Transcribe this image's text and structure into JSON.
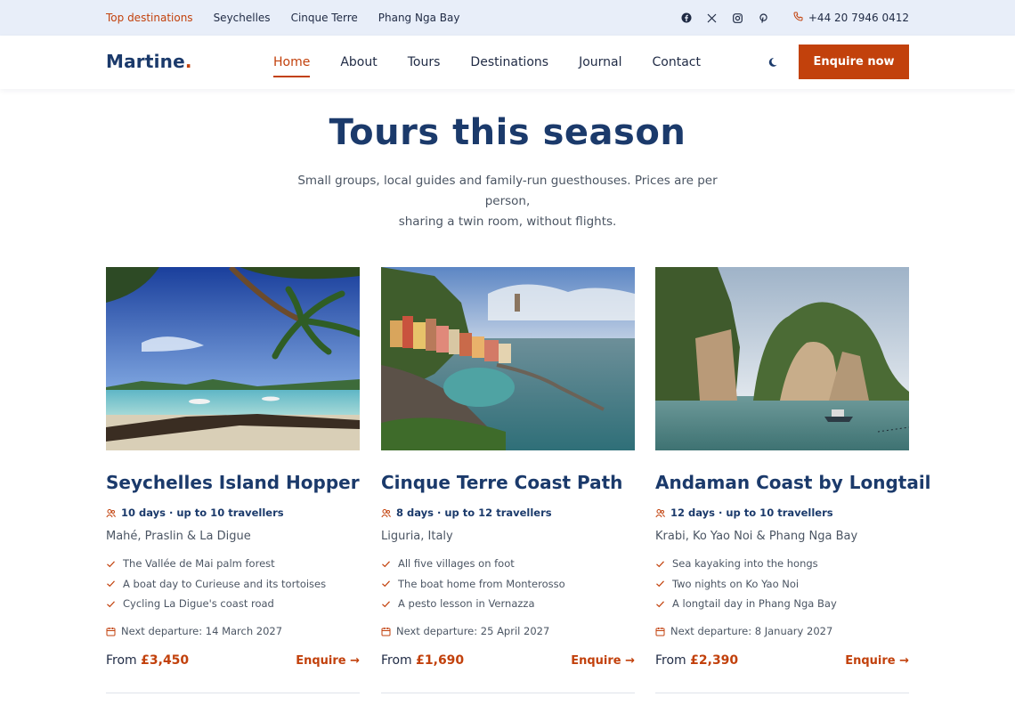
{
  "topbar": {
    "links": [
      {
        "label": "Top destinations"
      },
      {
        "label": "Seychelles"
      },
      {
        "label": "Cinque Terre"
      },
      {
        "label": "Phang Nga Bay"
      }
    ],
    "social_icons": [
      "facebook-icon",
      "x-icon",
      "instagram-icon",
      "pinterest-icon"
    ],
    "phone": "+44 20 7946 0412"
  },
  "header": {
    "logo": "Martine",
    "logo_dot": ".",
    "nav": [
      {
        "label": "Home"
      },
      {
        "label": "About"
      },
      {
        "label": "Tours"
      },
      {
        "label": "Destinations"
      },
      {
        "label": "Journal"
      },
      {
        "label": "Contact"
      }
    ],
    "cta": "Enquire now"
  },
  "hero": {
    "title": "Tours this season",
    "subtitle_line1": "Small groups, local guides and family-run guesthouses. Prices are per person,",
    "subtitle_line2": "sharing a twin room, without flights."
  },
  "tours": [
    {
      "title": "Seychelles Island Hopper",
      "meta": "10 days · up to 10 travellers",
      "location": "Mahé, Praslin & La Digue",
      "features": [
        "The Vallée de Mai palm forest",
        "A boat day to Curieuse and its tortoises",
        "Cycling La Digue's coast road"
      ],
      "departure": "Next departure: 14 March 2027",
      "price_prefix": "From",
      "price": "£3,450",
      "link": "Enquire →"
    },
    {
      "title": "Cinque Terre Coast Path",
      "meta": "8 days · up to 12 travellers",
      "location": "Liguria, Italy",
      "features": [
        "All five villages on foot",
        "The boat home from Monterosso",
        "A pesto lesson in Vernazza"
      ],
      "departure": "Next departure: 25 April 2027",
      "price_prefix": "From",
      "price": "£1,690",
      "link": "Enquire →"
    },
    {
      "title": "Andaman Coast by Longtail",
      "meta": "12 days · up to 10 travellers",
      "location": "Krabi, Ko Yao Noi & Phang Nga Bay",
      "features": [
        "Sea kayaking into the hongs",
        "Two nights on Ko Yao Noi",
        "A longtail day in Phang Nga Bay"
      ],
      "departure": "Next departure: 8 January 2027",
      "price_prefix": "From",
      "price": "£2,390",
      "link": "Enquire →"
    }
  ],
  "colors": {
    "accent": "#c2410c",
    "brand": "#1b3a6b",
    "topbar_bg": "#e8eef9"
  }
}
